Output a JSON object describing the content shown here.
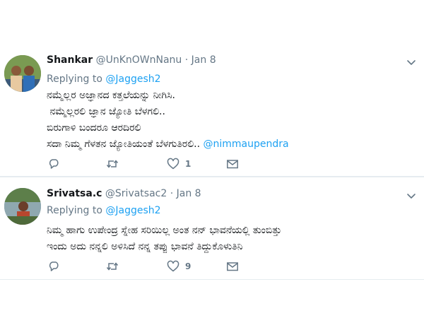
{
  "tweets": [
    {
      "name": "Shankar",
      "handle": "@UnKnOWnNanu",
      "separator": "·",
      "date": "Jan 8",
      "replying_label": "Replying to",
      "replying_to": "@Jaggesh2",
      "lines": [
        "ನಮ್ಮೆಲ್ಲರ ಅಜ್ಞಾನದ ಕತ್ತಲೆಯನ್ನು ನೀಗಿಸಿ.",
        " ನಮ್ಮೆಲ್ಲರಲಿ ಜ್ಞಾನ ಜ್ಯೋತಿ ಬೆಳಗಲಿ..",
        "ಬಿರುಗಾಳಿ ಬಂದರೂ ಆರದಿರಲಿ"
      ],
      "last_line": "ಸದಾ ನಿಮ್ಮ ಗೆಳತನ ಜ್ಯೋತಿಯಂತೆ ಬೆಳಗುತಿರಲಿ..",
      "last_line_mention": "@nimmaupendra",
      "like_count": "1",
      "icons": [
        "reply-icon",
        "retweet-icon",
        "heart-icon",
        "message-icon",
        "chevron-down-icon"
      ]
    },
    {
      "name": "Srivatsa.c",
      "handle": "@Srivatsac2",
      "separator": "·",
      "date": "Jan 8",
      "replying_label": "Replying to",
      "replying_to": "@Jaggesh2",
      "lines": [
        "ನಿಮ್ಮ ಹಾಗು ಉಪೇಂದ್ರ ಸ್ನೇಹ ಸರಿಯಿಲ್ಲ ಅಂತ ನನ್ ಭಾವನೆಯಲ್ಲಿ ತುಂಬಿತ್ತು",
        "ಇಂದು ಅದು ನನ್ನಲಿ ಅಳಿಸಿದೆ ನನ್ನ ತಪ್ಪು ಭಾವನೆ ತಿದ್ದುಕೊಳುತಿನಿ"
      ],
      "like_count": "9",
      "icons": [
        "reply-icon",
        "retweet-icon",
        "heart-icon",
        "message-icon",
        "chevron-down-icon"
      ]
    }
  ],
  "colors": {
    "link": "#1da1f2",
    "secondary": "#657786",
    "text": "#14171a",
    "divider": "#e6ecf0"
  }
}
